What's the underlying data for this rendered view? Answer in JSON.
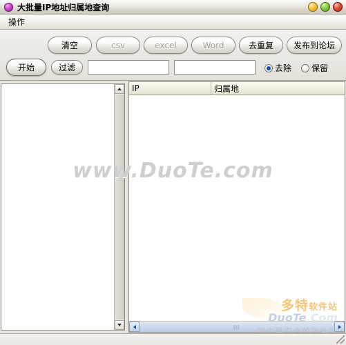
{
  "window": {
    "title": "大批量IP地址归属地查询",
    "icon": "app-globe-icon",
    "controls": {
      "minimize": "minimize",
      "maximize": "maximize",
      "close": "close"
    }
  },
  "menubar": {
    "items": [
      {
        "label": "操作"
      }
    ]
  },
  "toolbar": {
    "row1": [
      {
        "label": "清空",
        "disabled": false
      },
      {
        "label": "csv",
        "disabled": true
      },
      {
        "label": "excel",
        "disabled": true
      },
      {
        "label": "Word",
        "disabled": true
      },
      {
        "label": "去重复",
        "disabled": false
      },
      {
        "label": "发布到论坛",
        "disabled": false
      }
    ],
    "row2": {
      "start_label": "开始",
      "filter_label": "过滤",
      "input1_value": "",
      "input1_placeholder": "",
      "input2_value": "",
      "input2_placeholder": "",
      "radios": [
        {
          "label": "去除",
          "selected": true
        },
        {
          "label": "保留",
          "selected": false
        }
      ]
    }
  },
  "main": {
    "left_panel": {
      "name": "ip-input-textarea",
      "value": ""
    },
    "table": {
      "columns": [
        {
          "label": "IP"
        },
        {
          "label": "归属地"
        }
      ],
      "rows": []
    }
  },
  "watermark": {
    "text": "www.DuoTe.com",
    "logo_cn_main": "多特",
    "logo_cn_sub": "软件站",
    "logo_en_main": "DuoTe",
    "logo_en_sub": ".Com",
    "logo_tagline": "国内最安全的软件站"
  },
  "statusbar": {
    "text": ""
  },
  "colors": {
    "titlebar_text": "#000000",
    "accent_radio": "#1d4fa0",
    "header_bg": "#f1efe0",
    "disabled_text": "#a6a39c",
    "logo_orange": "#f0a22a",
    "logo_blue": "#9fb6d8"
  }
}
